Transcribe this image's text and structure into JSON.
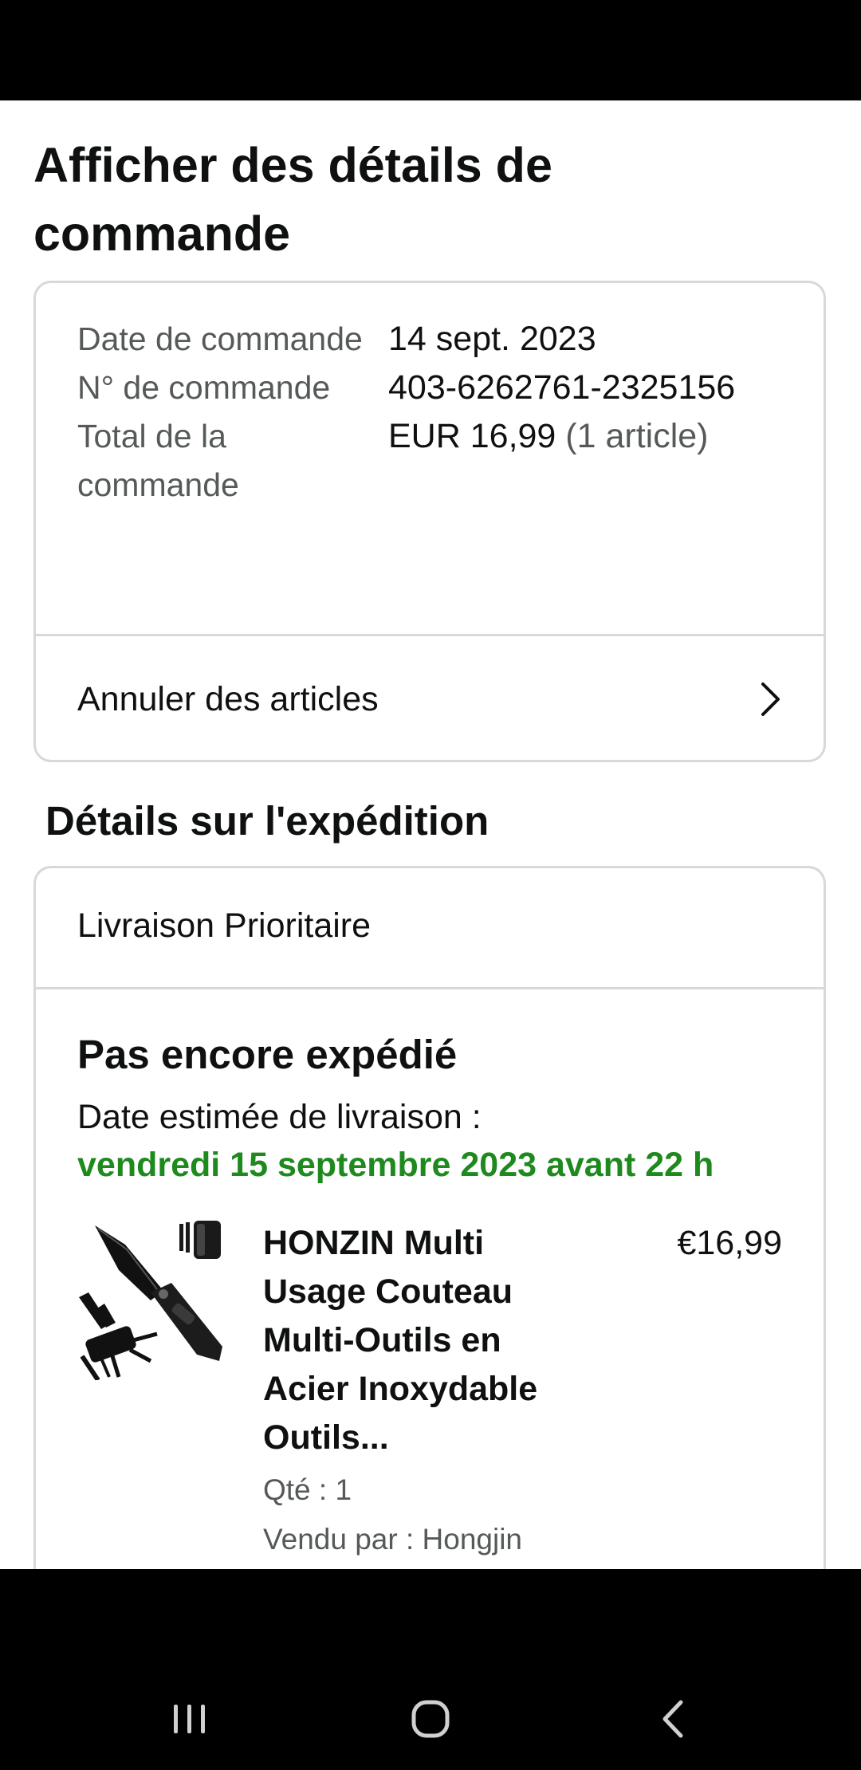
{
  "page": {
    "title": "Afficher des détails de commande"
  },
  "summary": {
    "rows": [
      {
        "label": "Date de commande",
        "value": "14 sept. 2023",
        "extra": ""
      },
      {
        "label": "N° de commande",
        "value": "403-6262761-2325156",
        "extra": ""
      },
      {
        "label": "Total de la commande",
        "value": "EUR 16,99",
        "extra": "(1 article)"
      }
    ],
    "cancel_label": "Annuler des articles"
  },
  "shipment": {
    "section_title": "Détails sur l'expédition",
    "method": "Livraison Prioritaire",
    "status": "Pas encore expédié",
    "delivery_label": "Date estimée de livraison :",
    "delivery_date": "vendredi 15 septembre 2023 avant 22 h",
    "delivery_color": "#1e8a1e",
    "item": {
      "title": "HONZIN Multi Usage Couteau Multi-Outils en Acier Inoxydable Outils...",
      "price": "€16,99",
      "quantity": "Qté : 1",
      "seller": "Vendu par : Hongjin",
      "image_icon": "multitool-knife-icon"
    }
  },
  "navigation": {
    "icons": [
      "recent-apps-icon",
      "home-icon",
      "back-icon"
    ]
  }
}
